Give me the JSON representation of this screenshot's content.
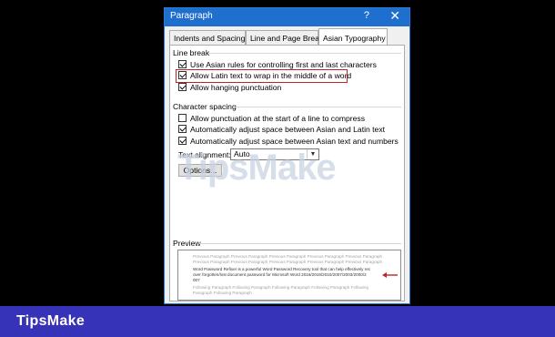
{
  "dialog": {
    "title": "Paragraph",
    "help_label": "?",
    "close_label": "✕",
    "tabs": [
      {
        "label": "Indents and Spacing",
        "active": false
      },
      {
        "label": "Line and Page Breaks",
        "active": false
      },
      {
        "label": "Asian Typography",
        "active": true
      }
    ],
    "line_break": {
      "heading": "Line break",
      "options": [
        {
          "label": "Use Asian rules for controlling first and last characters",
          "checked": true
        },
        {
          "label": "Allow Latin text to wrap in the middle of a word",
          "checked": true,
          "highlighted": true
        },
        {
          "label": "Allow hanging punctuation",
          "checked": true
        }
      ]
    },
    "character_spacing": {
      "heading": "Character spacing",
      "options": [
        {
          "label": "Allow punctuation at the start of a line to compress",
          "checked": false
        },
        {
          "label": "Automatically adjust space between Asian and Latin text",
          "checked": true
        },
        {
          "label": "Automatically adjust space between Asian text and numbers",
          "checked": true
        }
      ],
      "text_alignment_label": "Text alignment:",
      "text_alignment_value": "Auto",
      "options_button": "Options..."
    },
    "preview": {
      "heading": "Preview",
      "previous_lines": [
        "Previous Paragraph Previous Paragraph Previous Paragraph Previous Paragraph Previous Paragraph",
        "Previous Paragraph Previous Paragraph Previous Paragraph Previous Paragraph Previous Paragraph"
      ],
      "sample_lines": [
        "Word Password Refixer is a powerful Word Password Recovery tool that can help effectively rec",
        "over forgotten/lost document password for Microsoft Word 2016/2019/2010/2007/2003/2000/2",
        "007"
      ],
      "following_lines": [
        "Following Paragraph Following Paragraph Following Paragraph Following Paragraph Following",
        "Paragraph Following Paragraph"
      ]
    }
  },
  "watermark": "TipsMake",
  "brand": {
    "name": "TipsMake",
    "bar_color": "#3733b8"
  },
  "colors": {
    "titlebar": "#1f6fcf",
    "highlight": "#c0232b"
  }
}
